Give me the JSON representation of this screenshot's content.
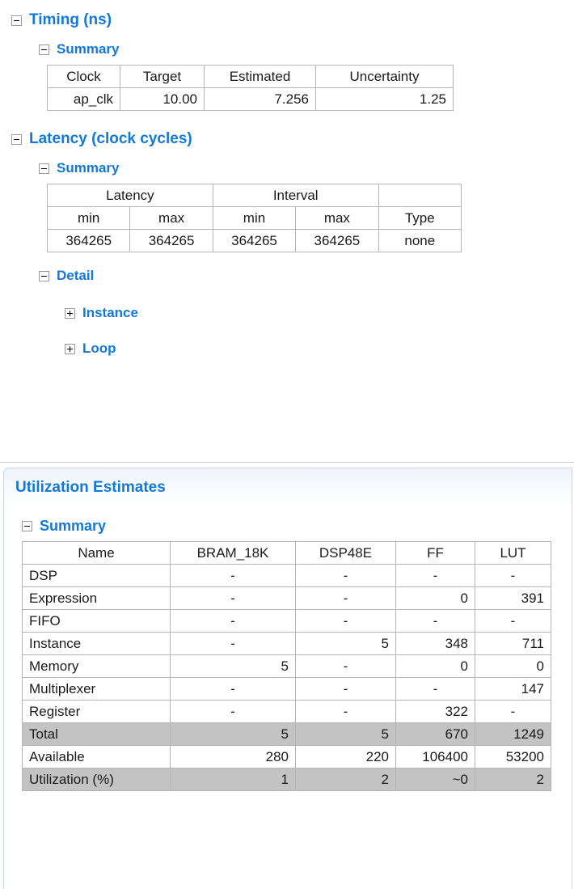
{
  "timing": {
    "heading": "Timing (ns)",
    "summary_heading": "Summary",
    "toggle_timing": "minus-icon",
    "toggle_summary": "minus-icon",
    "table": {
      "headers": [
        "Clock",
        "Target",
        "Estimated",
        "Uncertainty"
      ],
      "rows": [
        {
          "clock": "ap_clk",
          "target": "10.00",
          "estimated": "7.256",
          "uncertainty": "1.25"
        }
      ]
    }
  },
  "latency": {
    "heading": "Latency (clock cycles)",
    "summary_heading": "Summary",
    "detail_heading": "Detail",
    "instance_heading": "Instance",
    "loop_heading": "Loop",
    "table": {
      "group_headers": [
        "Latency",
        "Interval",
        ""
      ],
      "sub_headers": [
        "min",
        "max",
        "min",
        "max",
        "Type"
      ],
      "rows": [
        {
          "latency_min": "364265",
          "latency_max": "364265",
          "interval_min": "364265",
          "interval_max": "364265",
          "type": "none"
        }
      ]
    }
  },
  "utilization": {
    "section_title": "Utilization Estimates",
    "summary_heading": "Summary",
    "table": {
      "headers": [
        "Name",
        "BRAM_18K",
        "DSP48E",
        "FF",
        "LUT"
      ],
      "rows": [
        {
          "name": "DSP",
          "bram": "-",
          "dsp": "-",
          "ff": "-",
          "lut": "-",
          "shaded": false
        },
        {
          "name": "Expression",
          "bram": "-",
          "dsp": "-",
          "ff": "0",
          "lut": "391",
          "shaded": false
        },
        {
          "name": "FIFO",
          "bram": "-",
          "dsp": "-",
          "ff": "-",
          "lut": "-",
          "shaded": false
        },
        {
          "name": "Instance",
          "bram": "-",
          "dsp": "5",
          "ff": "348",
          "lut": "711",
          "shaded": false
        },
        {
          "name": "Memory",
          "bram": "5",
          "dsp": "-",
          "ff": "0",
          "lut": "0",
          "shaded": false
        },
        {
          "name": "Multiplexer",
          "bram": "-",
          "dsp": "-",
          "ff": "-",
          "lut": "147",
          "shaded": false
        },
        {
          "name": "Register",
          "bram": "-",
          "dsp": "-",
          "ff": "322",
          "lut": "-",
          "shaded": false
        },
        {
          "name": "Total",
          "bram": "5",
          "dsp": "5",
          "ff": "670",
          "lut": "1249",
          "shaded": true
        },
        {
          "name": "Available",
          "bram": "280",
          "dsp": "220",
          "ff": "106400",
          "lut": "53200",
          "shaded": false
        },
        {
          "name": "Utilization (%)",
          "bram": "1",
          "dsp": "2",
          "ff": "~0",
          "lut": "2",
          "shaded": true
        }
      ]
    }
  },
  "colors": {
    "heading_blue": "#1479d6",
    "grid_line": "#b4b4b4",
    "shade_gray": "#c3c3c3"
  }
}
